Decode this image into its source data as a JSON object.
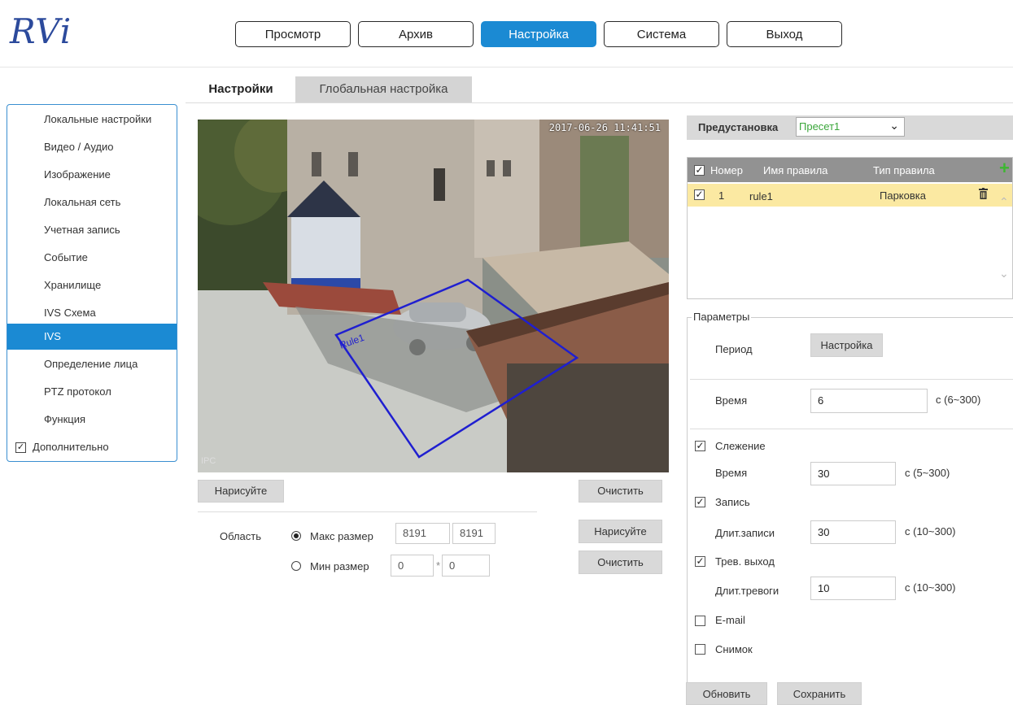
{
  "logo": "RVi",
  "nav": [
    "Просмотр",
    "Архив",
    "Настройка",
    "Система",
    "Выход"
  ],
  "tabs": {
    "settings": "Настройки",
    "global": "Глобальная настройка"
  },
  "menu": [
    "Локальные настройки",
    "Видео / Аудио",
    "Изображение",
    "Локальная сеть",
    "Учетная запись",
    "Событие",
    "Хранилище",
    "IVS Схема",
    "IVS",
    "Определение лица",
    "PTZ протокол",
    "Функция",
    "Дополнительно"
  ],
  "video": {
    "timestamp": "2017-06-26 11:41:51",
    "camera": "IPC",
    "rule_label": "Rule1"
  },
  "draw": {
    "draw_label": "Нарисуйте",
    "clear_label": "Очистить"
  },
  "area": {
    "label": "Область",
    "max_label": "Макс размер",
    "max_w": "8191",
    "max_h": "8191",
    "min_label": "Мин размер",
    "min_w": "0",
    "min_h": "0",
    "sep": "*",
    "draw_label": "Нарисуйте",
    "clear_label": "Очистить"
  },
  "preset": {
    "label": "Предустановка",
    "value": "Пресет1"
  },
  "rules": {
    "headers": {
      "number": "Номер",
      "name": "Имя правила",
      "type": "Тип правила"
    },
    "rows": [
      {
        "number": "1",
        "name": "rule1",
        "type": "Парковка"
      }
    ]
  },
  "params": {
    "legend": "Параметры",
    "period_label": "Период",
    "period_button": "Настройка",
    "time_label": "Время",
    "time_value": "6",
    "time_range": "с (6~300)",
    "tracking_label": "Слежение",
    "tracking_time_label": "Время",
    "tracking_time_value": "30",
    "tracking_range": "с (5~300)",
    "record_label": "Запись",
    "record_dur_label": "Длит.записи",
    "record_dur_value": "30",
    "record_range": "с (10~300)",
    "alarm_label": "Трев. выход",
    "alarm_dur_label": "Длит.тревоги",
    "alarm_dur_value": "10",
    "alarm_range": "с (10~300)",
    "email_label": "E-mail",
    "snapshot_label": "Снимок"
  },
  "footer": {
    "refresh": "Обновить",
    "save": "Сохранить"
  },
  "colors": {
    "accent": "#1b8ad3",
    "rule_line": "#1f1fd0",
    "row_highlight": "#fbe9a2",
    "add_icon": "#3cb731"
  }
}
